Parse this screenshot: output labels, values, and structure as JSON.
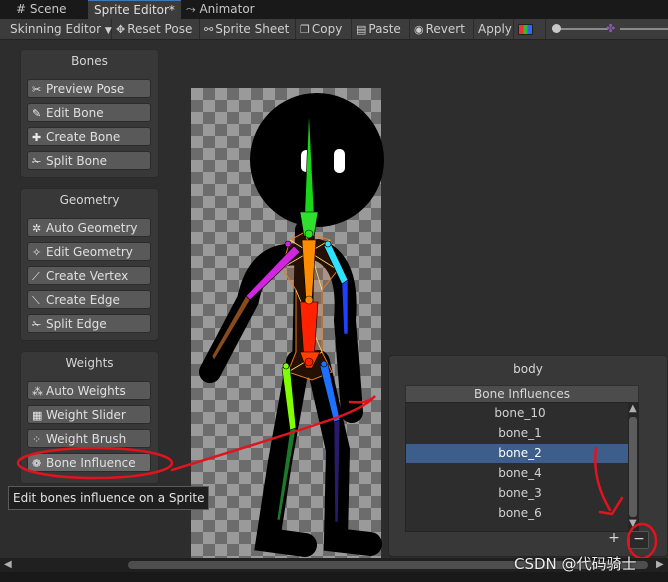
{
  "tabs": [
    {
      "icon": "grid-icon",
      "label": "Scene"
    },
    {
      "label": "Sprite Editor*"
    },
    {
      "icon": "animator-icon",
      "label": "Animator"
    }
  ],
  "toolbar": {
    "mode": "Skinning Editor",
    "reset_pose": "Reset Pose",
    "sprite_sheet": "Sprite Sheet",
    "copy": "Copy",
    "paste": "Paste",
    "revert": "Revert",
    "apply": "Apply"
  },
  "bones_panel": {
    "title": "Bones",
    "tools": [
      "Preview Pose",
      "Edit Bone",
      "Create Bone",
      "Split Bone"
    ]
  },
  "geometry_panel": {
    "title": "Geometry",
    "tools": [
      "Auto Geometry",
      "Edit Geometry",
      "Create Vertex",
      "Create Edge",
      "Split Edge"
    ]
  },
  "weights_panel": {
    "title": "Weights",
    "tools": [
      "Auto Weights",
      "Weight Slider",
      "Weight Brush",
      "Bone Influence"
    ],
    "selected": "Bone Influence"
  },
  "tooltip": "Edit bones influence on a Sprite",
  "influence_window": {
    "title": "body",
    "list_header": "Bone Influences",
    "bones": [
      "bone_10",
      "bone_1",
      "bone_2",
      "bone_4",
      "bone_3",
      "bone_6"
    ],
    "selected": "bone_2",
    "add_label": "+",
    "remove_label": "−"
  },
  "watermark": "CSDN @代码骑士",
  "colors": {
    "accent": "#3a79bb",
    "selection": "#3d5e8a",
    "annotation": "#e0141e"
  }
}
